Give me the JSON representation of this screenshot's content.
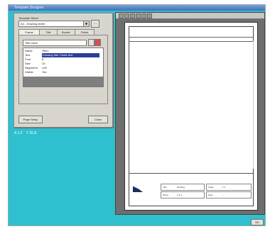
{
  "window": {
    "title": "Template Designer"
  },
  "dialog": {
    "group_label": "Template Sheet",
    "template_value": "A4 - Drawing sheet",
    "square_button": "...",
    "tabs": [
      "Frame",
      "Title",
      "Border",
      "Fields"
    ],
    "item_combo_value": "Title block",
    "properties": [
      {
        "key": "Name",
        "value": "Title1"
      },
      {
        "key": "Text",
        "value": "Drawing title / block text"
      },
      {
        "key": "Font",
        "value": "8"
      },
      {
        "key": "Size",
        "value": "10"
      },
      {
        "key": "Alignment",
        "value": "Left"
      },
      {
        "key": "Visible",
        "value": "Yes"
      }
    ],
    "left_button": "Page Setup",
    "right_button": "Close"
  },
  "status": {
    "left": "A 1.0",
    "right": "Y 30.8"
  },
  "preview": {
    "title_block": {
      "row1": [
        "Title",
        "Drawing"
      ],
      "row2": [
        "Scale",
        "1:1"
      ],
      "row3": [
        "Sheet",
        "1 of 1"
      ],
      "row4": [
        "Date",
        "--"
      ]
    }
  },
  "footer": {
    "ok_label": "OK"
  }
}
